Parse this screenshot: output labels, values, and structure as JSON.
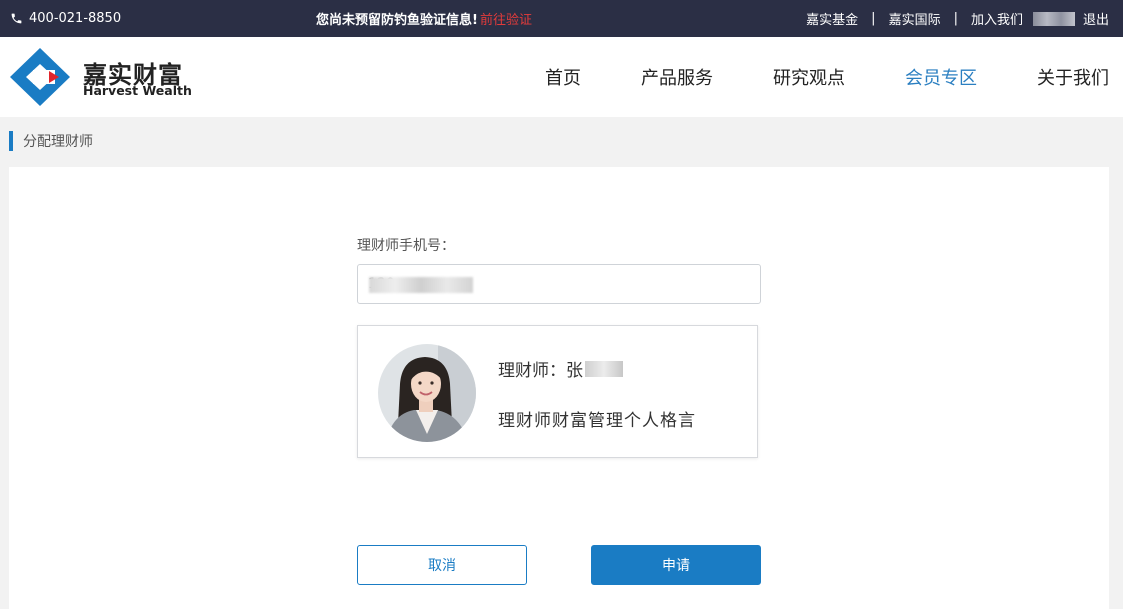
{
  "topbar": {
    "phone": "400-021-8850",
    "notice": "您尚未预留防钓鱼验证信息!",
    "notice_link": "前往验证",
    "links": [
      "嘉实基金",
      "嘉实国际",
      "加入我们"
    ],
    "separator": "|",
    "logout": "退出"
  },
  "header": {
    "logo_cn": "嘉实财富",
    "logo_en": "Harvest Wealth",
    "nav": [
      {
        "label": "首页"
      },
      {
        "label": "产品服务"
      },
      {
        "label": "研究观点"
      },
      {
        "label": "会员专区",
        "active": true
      },
      {
        "label": "关于我们"
      }
    ]
  },
  "breadcrumb": "分配理财师",
  "form": {
    "phone_label": "理财师手机号：",
    "phone_value": "130",
    "advisor_name_prefix": "理财师：张",
    "advisor_motto": "理财师财富管理个人格言",
    "cancel_label": "取消",
    "apply_label": "申请"
  },
  "colors": {
    "topbar_bg": "#2b2f45",
    "accent": "#1a7cc4",
    "warning": "#e23b3b",
    "nav_active": "#2b7fc1"
  },
  "icons": {
    "phone": "phone-icon",
    "logo": "harvest-logo-icon"
  }
}
